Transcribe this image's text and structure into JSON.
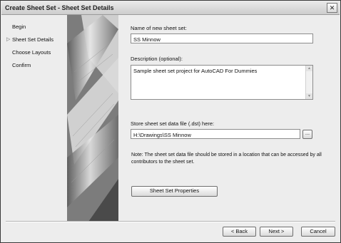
{
  "window": {
    "title": "Create Sheet Set - Sheet Set Details",
    "close_glyph": "✕"
  },
  "nav": {
    "items": [
      {
        "label": "Begin",
        "current": false
      },
      {
        "label": "Sheet Set Details",
        "current": true
      },
      {
        "label": "Choose Layouts",
        "current": false
      },
      {
        "label": "Confirm",
        "current": false
      }
    ],
    "current_marker": "▷"
  },
  "form": {
    "name_label": "Name of new sheet set:",
    "name_value": "SS Minnow",
    "description_label": "Description (optional):",
    "description_value": "Sample sheet set project for AutoCAD For Dummies",
    "storage_label": "Store sheet set data file (.dst) here:",
    "storage_value": "H:\\Drawings\\SS Minnow",
    "browse_label": "...",
    "note": "Note: The sheet set data file should be stored in a location that can be accessed by all contributors to the sheet set.",
    "properties_button": "Sheet Set Properties"
  },
  "footer": {
    "back": "< Back",
    "next": "Next >",
    "cancel": "Cancel"
  }
}
